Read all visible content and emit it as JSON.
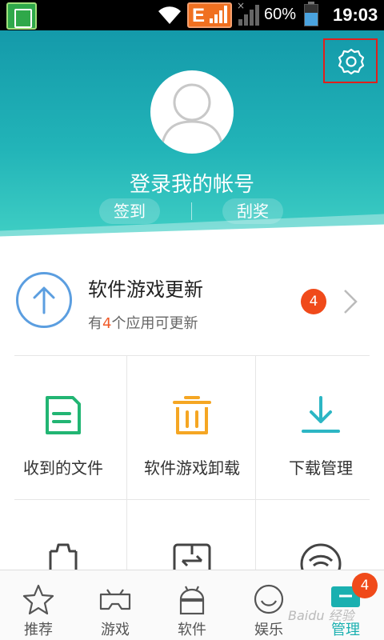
{
  "status_bar": {
    "network_letter": "E",
    "no_signal_mark": "×",
    "battery_percent": "60%",
    "time": "19:03"
  },
  "header": {
    "login_text": "登录我的帐号",
    "sign_in_label": "签到",
    "scratch_label": "刮奖",
    "settings_icon": "gear-icon"
  },
  "update": {
    "title": "软件游戏更新",
    "sub_prefix": "有",
    "sub_count": "4",
    "sub_suffix": "个应用可更新",
    "badge": "4"
  },
  "tiles": [
    {
      "label": "收到的文件",
      "icon": "received-file-icon",
      "color": "#22b573"
    },
    {
      "label": "软件游戏卸载",
      "icon": "trash-icon",
      "color": "#f5a623"
    },
    {
      "label": "下载管理",
      "icon": "download-icon",
      "color": "#2cb6c4"
    }
  ],
  "nav": [
    {
      "label": "推荐",
      "icon": "star-icon"
    },
    {
      "label": "游戏",
      "icon": "gamepad-icon"
    },
    {
      "label": "软件",
      "icon": "android-icon"
    },
    {
      "label": "娱乐",
      "icon": "smiley-icon"
    },
    {
      "label": "管理",
      "icon": "manage-icon",
      "badge": "4"
    }
  ],
  "watermark": "Baidu 经验",
  "colors": {
    "teal": "#1ab0b0",
    "badge": "#f04a1a",
    "highlight_box": "#e0201c"
  }
}
